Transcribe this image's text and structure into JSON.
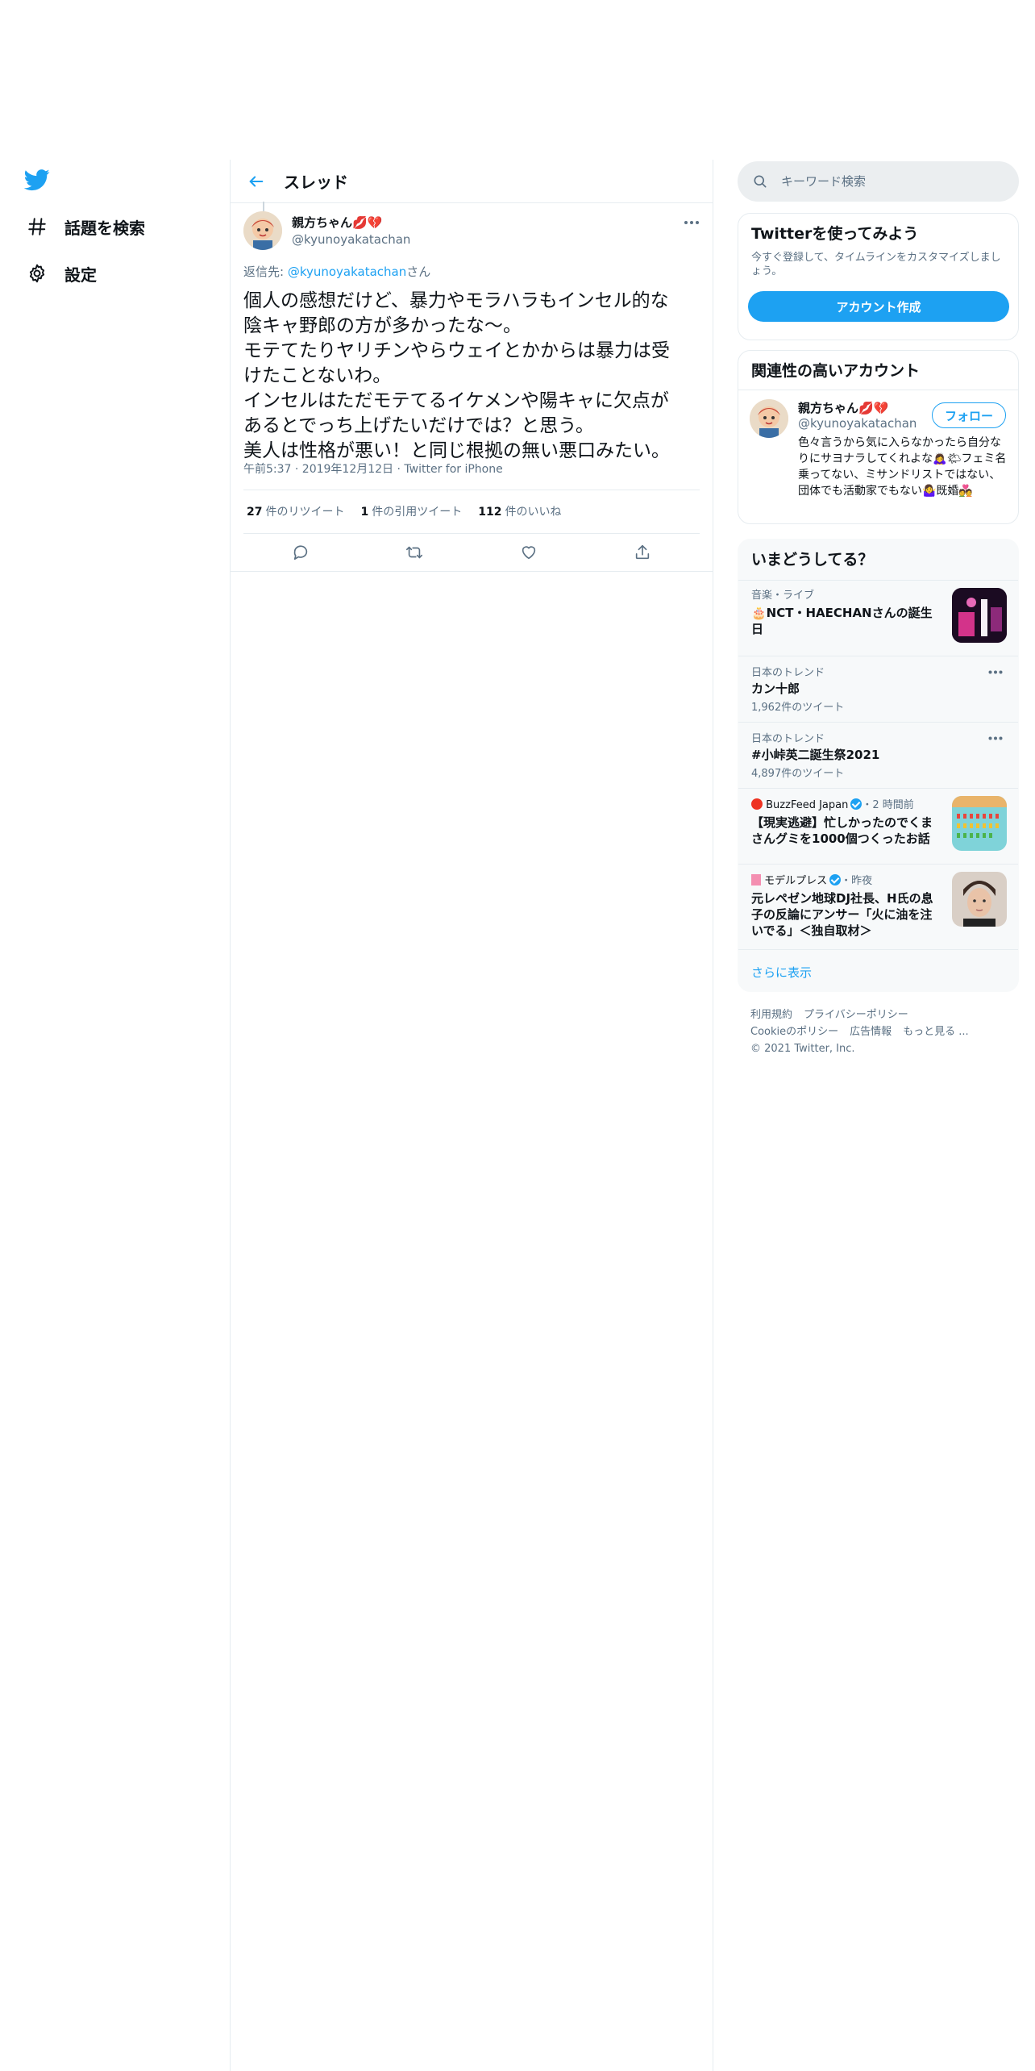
{
  "nav": {
    "items": [
      {
        "label": "話題を検索",
        "icon": "hashtag-icon"
      },
      {
        "label": "設定",
        "icon": "gear-icon"
      }
    ]
  },
  "header": {
    "title": "スレッド"
  },
  "tweet": {
    "display_name": "親方ちゃん💋💔",
    "handle": "@kyunoyakatachan",
    "reply_prefix": "返信先: ",
    "reply_handle": "@kyunoyakatachan",
    "reply_suffix": "さん",
    "text": "個人の感想だけど、暴力やモラハラもインセル的な\n陰キャ野郎の方が多かったな〜。\nモテてたりヤリチンやらウェイとかからは暴力は受\nけたことないわ。\nインセルはただモテてるイケメンや陽キャに欠点が\nあるとでっち上げたいだけでは？と思う。\n美人は性格が悪い！と同じ根拠の無い悪口みたい。",
    "timestamp": "午前5:37 · 2019年12月12日 · Twitter for iPhone",
    "stats": {
      "retweets_count": "27",
      "retweets_label": "件のリツイート",
      "quotes_count": "1",
      "quotes_label": "件の引用ツイート",
      "likes_count": "112",
      "likes_label": "件のいいね"
    }
  },
  "search": {
    "placeholder": "キーワード検索"
  },
  "signup": {
    "title": "Twitterを使ってみよう",
    "desc": "今すぐ登録して、タイムラインをカスタマイズしましょう。",
    "button": "アカウント作成"
  },
  "related": {
    "title": "関連性の高いアカウント",
    "name": "親方ちゃん💋💔",
    "handle": "@kyunoyakatachan",
    "follow_label": "フォロー",
    "bio": "色々言うから気に入らなかったら自分なりにサヨナラしてくれよな🙇‍♀️🌤フェミ名乗ってない、ミサンドリストではない、団体でも活動家でもない🤷‍♀️既婚💑"
  },
  "trends": {
    "title": "いまどうしてる？",
    "items": [
      {
        "category": "音楽・ライブ",
        "title": "🎂NCT・HAECHANさんの誕生日"
      },
      {
        "category": "日本のトレンド",
        "title": "カン十郎",
        "count": "1,962件のツイート"
      },
      {
        "category": "日本のトレンド",
        "title": "#小峠英二誕生祭2021",
        "count": "4,897件のツイート"
      },
      {
        "source": "BuzzFeed Japan",
        "time": "・2 時間前",
        "title": "【現実逃避】忙しかったのでくまさんグミを1000個つくったお話"
      },
      {
        "source": "モデルプレス",
        "time": "・昨夜",
        "title": "元レペゼン地球DJ社長、H氏の息子の反論にアンサー「火に油を注いでる」＜独自取材＞"
      }
    ],
    "show_more": "さらに表示"
  },
  "footer": {
    "terms": "利用規約",
    "privacy": "プライバシーポリシー",
    "cookie": "Cookieのポリシー",
    "ads": "広告情報",
    "more": "もっと見る ...",
    "copyright": "© 2021 Twitter, Inc."
  },
  "colors": {
    "accent": "#1da1f2",
    "muted": "#5b7083",
    "border": "#e6ecf0"
  }
}
